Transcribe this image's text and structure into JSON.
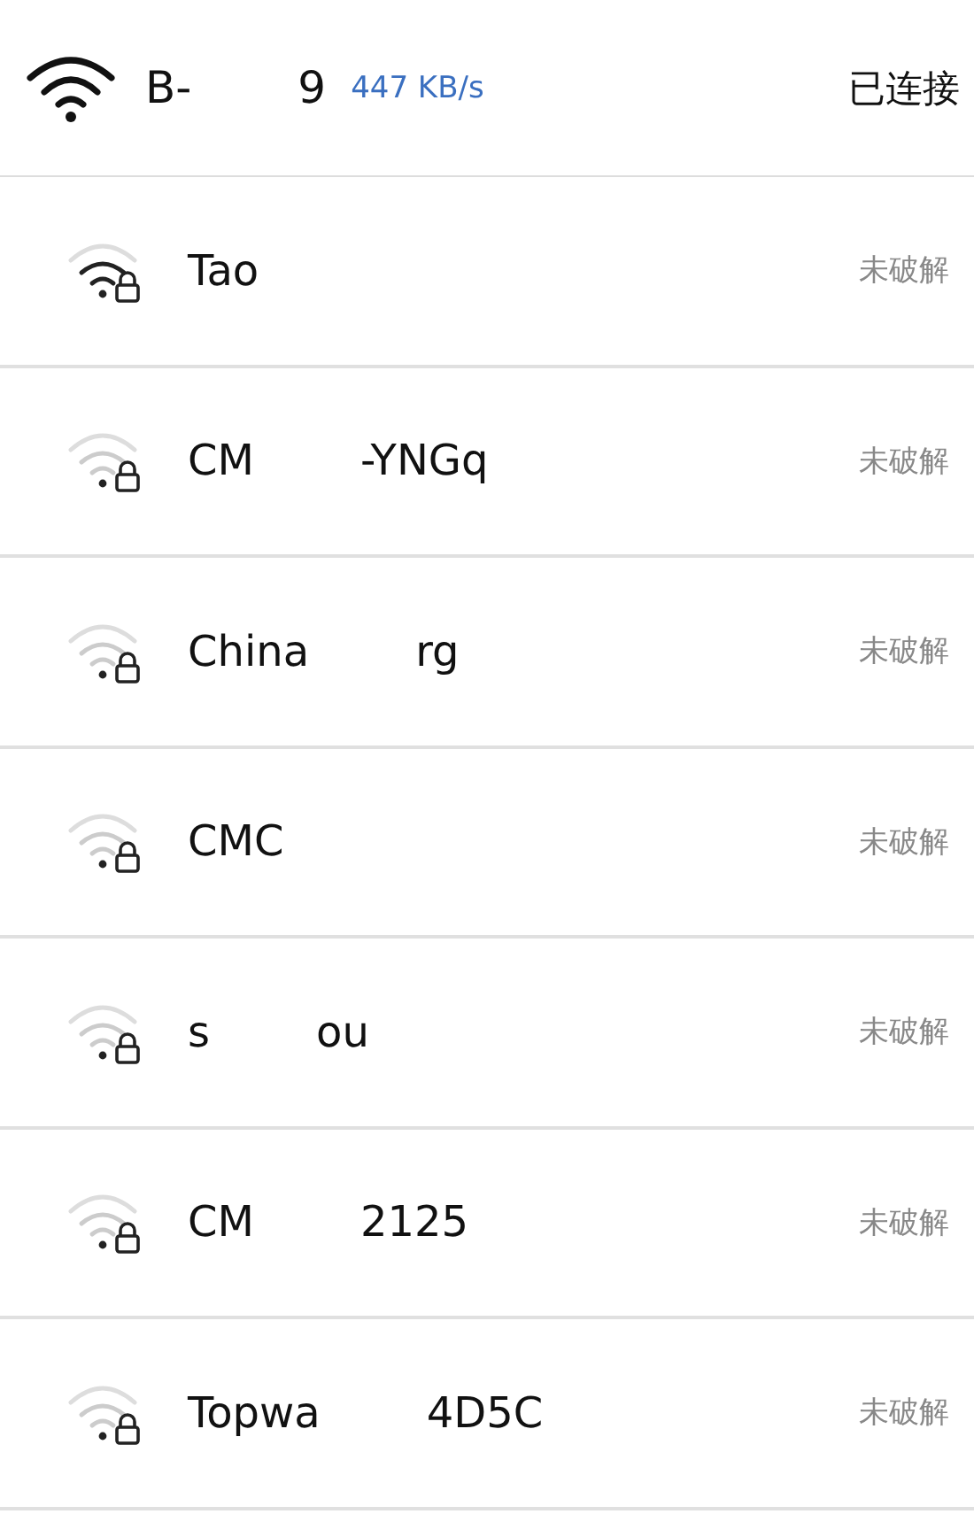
{
  "connected": {
    "name_parts": [
      "B-",
      "9"
    ],
    "speed": "447 KB/s",
    "status": "已连接"
  },
  "networks": [
    {
      "name_parts": [
        "Tao"
      ],
      "strong_signal": true,
      "locked": true,
      "status": "未破解"
    },
    {
      "name_parts": [
        "CM",
        "-YNGq"
      ],
      "strong_signal": false,
      "locked": true,
      "status": "未破解"
    },
    {
      "name_parts": [
        "China",
        "rg"
      ],
      "strong_signal": false,
      "locked": true,
      "status": "未破解"
    },
    {
      "name_parts": [
        "CMC"
      ],
      "strong_signal": false,
      "locked": true,
      "status": "未破解"
    },
    {
      "name_parts": [
        "s",
        "ou"
      ],
      "strong_signal": false,
      "locked": true,
      "status": "未破解"
    },
    {
      "name_parts": [
        "CM",
        "2125"
      ],
      "strong_signal": false,
      "locked": true,
      "status": "未破解"
    },
    {
      "name_parts": [
        "Topwa",
        "4D5C"
      ],
      "strong_signal": false,
      "locked": true,
      "status": "未破解"
    }
  ]
}
